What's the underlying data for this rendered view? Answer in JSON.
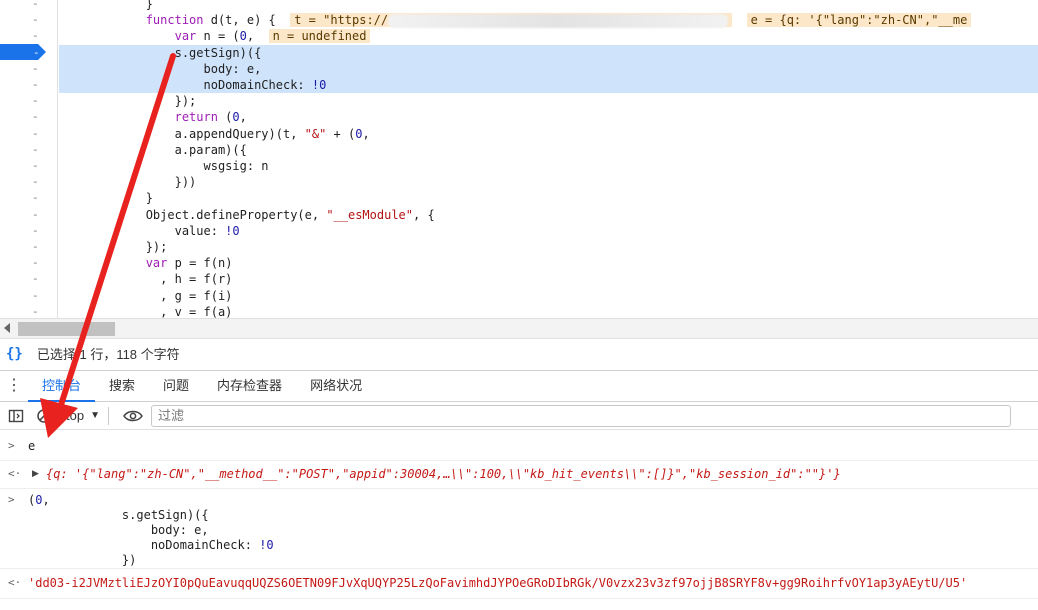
{
  "editor": {
    "lines": [
      {
        "indent": "            ",
        "code": "}",
        "highlight": false
      },
      {
        "indent": "            ",
        "code": "function d(t, e) {",
        "highlight": false,
        "inline": [
          "t = \"https://",
          "e = {q: '{\"lang\":\"zh-CN\",\"__me"
        ]
      },
      {
        "indent": "                ",
        "code": "var n = (0,",
        "highlight": false,
        "inline": [
          "n = undefined"
        ]
      },
      {
        "indent": "                ",
        "code": "s.getSign)({",
        "highlight": true
      },
      {
        "indent": "                    ",
        "code": "body: e,",
        "highlight": true
      },
      {
        "indent": "                    ",
        "code": "noDomainCheck: !0",
        "highlight": true
      },
      {
        "indent": "                ",
        "code": "});",
        "highlight": false
      },
      {
        "indent": "                ",
        "code": "return (0,",
        "highlight": false
      },
      {
        "indent": "                ",
        "code": "a.appendQuery)(t, \"&\" + (0,",
        "highlight": false
      },
      {
        "indent": "                ",
        "code": "a.param)({",
        "highlight": false
      },
      {
        "indent": "                    ",
        "code": "wsgsig: n",
        "highlight": false
      },
      {
        "indent": "                ",
        "code": "}))",
        "highlight": false
      },
      {
        "indent": "            ",
        "code": "}",
        "highlight": false
      },
      {
        "indent": "            ",
        "code": "Object.defineProperty(e, \"__esModule\", {",
        "highlight": false
      },
      {
        "indent": "                ",
        "code": "value: !0",
        "highlight": false
      },
      {
        "indent": "            ",
        "code": "});",
        "highlight": false
      },
      {
        "indent": "            ",
        "code": "var p = f(n)",
        "highlight": false
      },
      {
        "indent": "              ",
        "code": ", h = f(r)",
        "highlight": false
      },
      {
        "indent": "              ",
        "code": ", g = f(i)",
        "highlight": false
      },
      {
        "indent": "              ",
        "code": ", v = f(a)",
        "highlight": false
      }
    ],
    "gutter_mark": "-"
  },
  "status": {
    "braces": "{}",
    "selection": "已选择 1 行，118 个字符"
  },
  "drawer": {
    "tabs": [
      "控制台",
      "搜索",
      "问题",
      "内存检查器",
      "网络状况"
    ],
    "active_tab": 0
  },
  "toolbar": {
    "context": "top",
    "filter_placeholder": "过滤"
  },
  "console": {
    "input1": "e",
    "output1": "{q: '{\"lang\":\"zh-CN\",\"__method__\":\"POST\",\"appid\":30004,…\\\\\":100,\\\\\"kb_hit_events\\\\\":[]}\",\"kb_session_id\":\"\"}'}",
    "input2_lines": [
      "(0,",
      "             s.getSign)({",
      "                 body: e,",
      "                 noDomainCheck: !0",
      "             })"
    ],
    "output2": "'dd03-i2JVMztliEJzOYI0pQuEavuqqUQZS6OETN09FJvXqUQYP25LzQoFavimhdJYPOeGRoDIbRGk/V0vzx23v3zf97ojjB8SRYF8v+gg9RoihrfvOY1ap3yAEytU/U5'"
  },
  "colors": {
    "accent": "#1a73e8",
    "highlight": "#cfe4fb",
    "annotation_arrow": "#e8231f"
  }
}
